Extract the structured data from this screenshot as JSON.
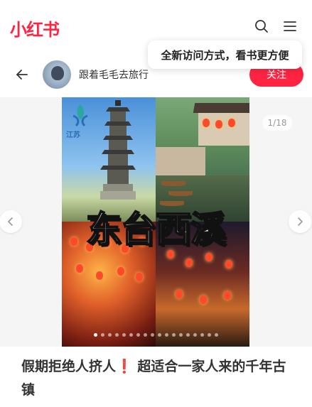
{
  "header": {
    "logo_text": "小红书",
    "brand_color": "#ff2442",
    "search_icon": "search-icon",
    "menu_icon": "hamburger-menu-icon"
  },
  "tooltip": {
    "text": "全新访问方式，看书更方便"
  },
  "author": {
    "back_icon": "back-arrow-icon",
    "name": "跟着毛毛去旅行",
    "follow_label": "关注"
  },
  "viewer": {
    "page_counter": "1/18",
    "current_page": 1,
    "total_pages": 18,
    "overlay_title": "东台西溪",
    "logo_text": "江苏",
    "prev_icon": "chevron-left-icon",
    "next_icon": "chevron-right-icon"
  },
  "post": {
    "title_part1": "假期拒绝人挤人",
    "title_mark": "❗",
    "title_part2": "超适合一家人来的千年古镇"
  }
}
